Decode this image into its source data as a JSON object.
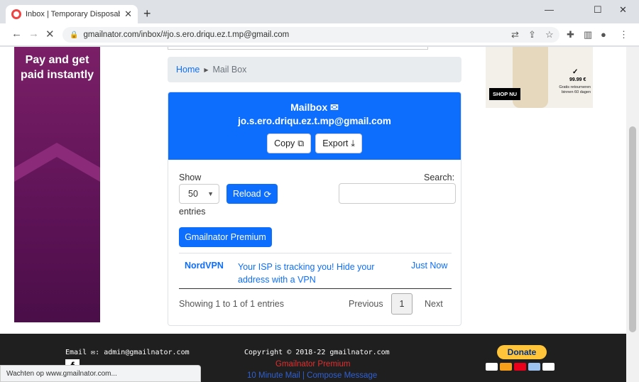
{
  "browser": {
    "tab_title": "Inbox | Temporary Disposable Gm",
    "tab_close": "✕",
    "new_tab": "+",
    "url": "gmailnator.com/inbox/#jo.s.ero.driqu.ez.t.mp@gmail.com",
    "status_text": "Wachten op www.gmailnator.com..."
  },
  "ads": {
    "left_text": "Pay and get paid instantly",
    "right_shop": "SHOP NU",
    "right_price": "99.99 €",
    "right_returns": "Gratis retourneren binnen 60 dagen"
  },
  "breadcrumb": {
    "home": "Home",
    "current": "Mail Box"
  },
  "mailbox": {
    "title": "Mailbox",
    "email": "jo.s.ero.driqu.ez.t.mp@gmail.com",
    "copy_label": "Copy",
    "export_label": "Export"
  },
  "table_controls": {
    "show_label": "Show",
    "length_value": "50",
    "entries_label": "entries",
    "reload_label": "Reload",
    "search_label": "Search:",
    "premium_label": "Gmailnator Premium"
  },
  "messages": [
    {
      "from": "NordVPN",
      "subject": "Your ISP is tracking you! Hide your address with a VPN",
      "time": "Just Now"
    }
  ],
  "pagination": {
    "info": "Showing 1 to 1 of 1 entries",
    "previous": "Previous",
    "page": "1",
    "next": "Next"
  },
  "footer": {
    "email_label": "Email",
    "email_value": ": admin@gmailnator.com",
    "copyright": "Copyright © 2018-22 gmailnator.com",
    "premium_link": "Gmailnator Premium",
    "links": "10 Minute Mail | Compose Message",
    "donate": "Donate",
    "facebook": "f"
  },
  "colors": {
    "primary": "#0d6efd",
    "footer_bg": "#1f1f1f",
    "ad_purple": "#6b1a60"
  }
}
